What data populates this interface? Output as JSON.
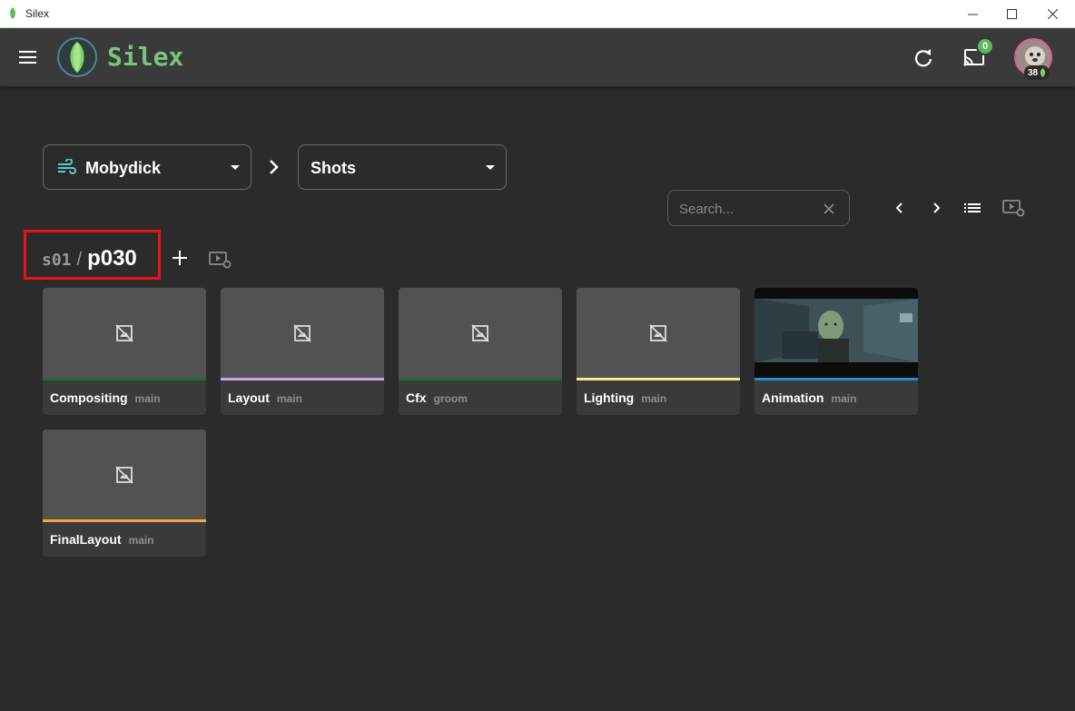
{
  "window": {
    "title": "Silex"
  },
  "header": {
    "brand": "Silex",
    "cast_count": "0",
    "user_level": "38"
  },
  "project_select": {
    "label": "Mobydick"
  },
  "type_select": {
    "label": "Shots"
  },
  "search": {
    "placeholder": "Search..."
  },
  "breadcrumb": {
    "sequence": "s01",
    "separator": "/",
    "shot": "p030"
  },
  "tasks": [
    {
      "name": "Compositing",
      "variant": "main",
      "color": "#1f6b2b",
      "has_preview": false
    },
    {
      "name": "Layout",
      "variant": "main",
      "color": "#c9a3e6",
      "has_preview": false
    },
    {
      "name": "Cfx",
      "variant": "groom",
      "color": "#1f6b2b",
      "has_preview": false
    },
    {
      "name": "Lighting",
      "variant": "main",
      "color": "#f0ec8a",
      "has_preview": false
    },
    {
      "name": "Animation",
      "variant": "main",
      "color": "#1e8fd6",
      "has_preview": true
    },
    {
      "name": "FinalLayout",
      "variant": "main",
      "color": "#f2a93b",
      "has_preview": false
    }
  ],
  "colors": {
    "accent_green": "#7cc47a",
    "highlight_red": "#e8141b"
  }
}
